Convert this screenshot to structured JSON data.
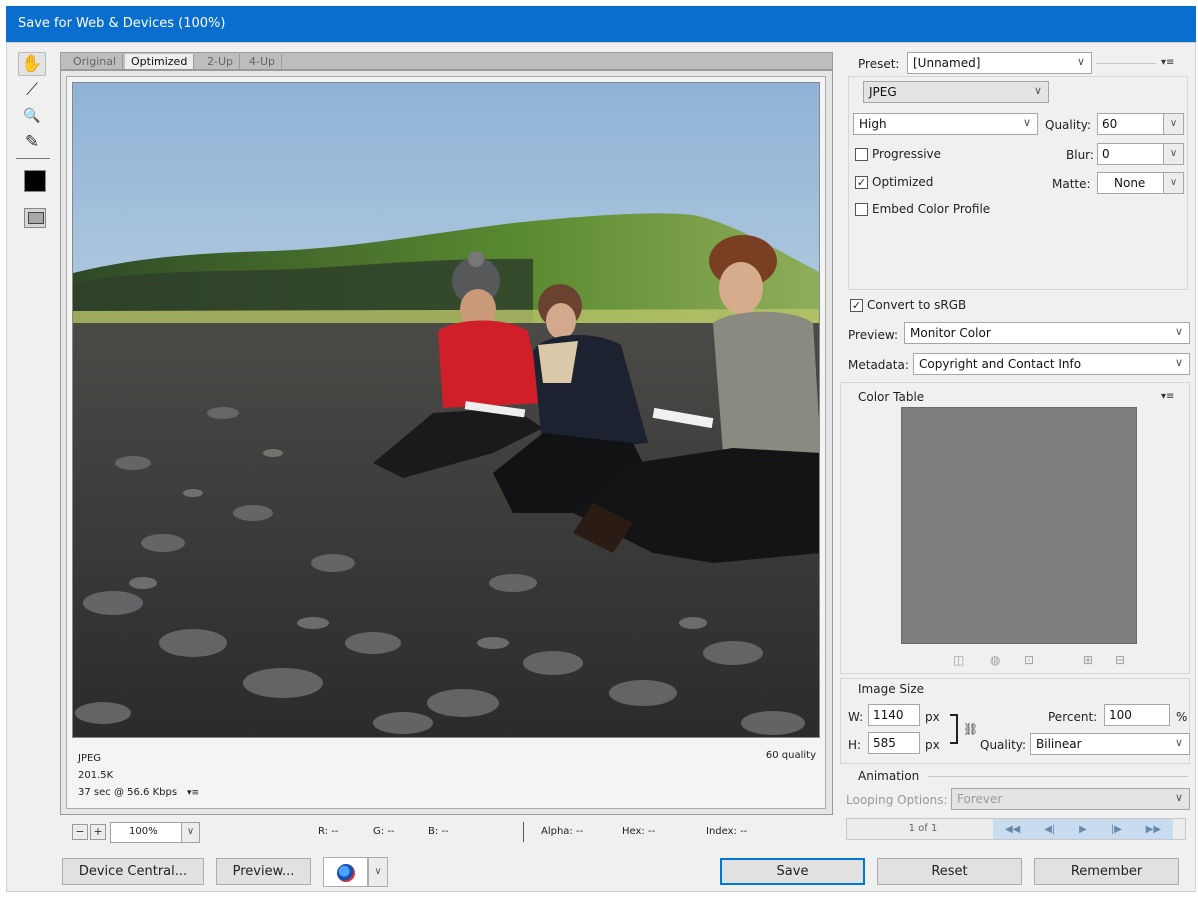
{
  "window": {
    "title": "Save for Web & Devices (100%)"
  },
  "tools": {
    "items": [
      {
        "name": "hand-tool",
        "glyph": "✋"
      },
      {
        "name": "slice-select-tool",
        "glyph": "⟋"
      },
      {
        "name": "zoom-tool",
        "glyph": "🔍"
      },
      {
        "name": "eyedropper-tool",
        "glyph": "✎"
      }
    ]
  },
  "view_tabs": [
    "Original",
    "Optimized",
    "2-Up",
    "4-Up"
  ],
  "preview_info": {
    "format": "JPEG",
    "size": "201.5K",
    "download": "37 sec @ 56.6 Kbps",
    "menu_glyph": "▾≡",
    "quality": "60 quality"
  },
  "status": {
    "zoom_minus": "−",
    "zoom_plus": "+",
    "zoom": "100%",
    "r": "R: --",
    "g": "G: --",
    "b": "B: --",
    "alpha": "Alpha: --",
    "hex": "Hex: --",
    "index": "Index: --"
  },
  "buttons": {
    "device_central": "Device Central...",
    "preview": "Preview...",
    "save": "Save",
    "reset": "Reset",
    "remember": "Remember"
  },
  "settings": {
    "preset_label": "Preset:",
    "preset_value": "[Unnamed]",
    "format": "JPEG",
    "quality_level": "High",
    "quality_label": "Quality:",
    "quality_value": "60",
    "progressive_label": "Progressive",
    "blur_label": "Blur:",
    "blur_value": "0",
    "optimized_label": "Optimized",
    "matte_label": "Matte:",
    "matte_value": "None",
    "embed_profile_label": "Embed Color Profile",
    "convert_srgb_label": "Convert to sRGB",
    "preview_label": "Preview:",
    "preview_value": "Monitor Color",
    "metadata_label": "Metadata:",
    "metadata_value": "Copyright and Contact Info",
    "checked_glyph": "✓"
  },
  "color_table": {
    "title": "Color Table"
  },
  "image_size": {
    "title": "Image Size",
    "w_label": "W:",
    "w_value": "1140",
    "h_label": "H:",
    "h_value": "585",
    "unit": "px",
    "percent_label": "Percent:",
    "percent_value": "100",
    "percent_unit": "%",
    "quality_label": "Quality:",
    "quality_value": "Bilinear"
  },
  "animation": {
    "title": "Animation",
    "looping_label": "Looping Options:",
    "looping_value": "Forever",
    "frame": "1 of 1"
  },
  "colors": {
    "titlebar": "#0a6ecf",
    "dialog_bg": "#f0f0f0",
    "color_table_bg": "#7d7d7d",
    "default_button_border": "#0078d7"
  }
}
